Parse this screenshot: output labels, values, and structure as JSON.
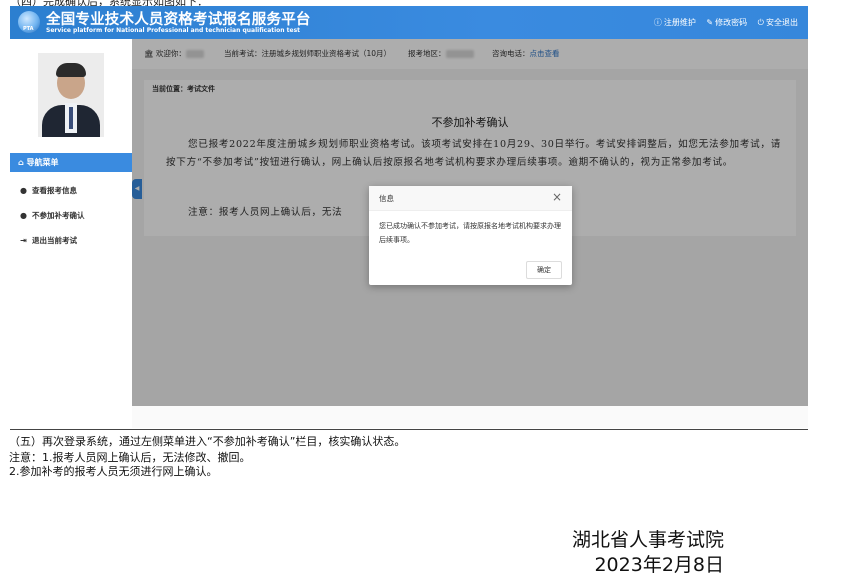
{
  "doc": {
    "top_cut_text": "（四）完成确认后，系统显示如图如下：",
    "step5": "（五）再次登录系统，通过左侧菜单进入“不参加补考确认”栏目，核实确认状态。",
    "note1": "注意：1.报考人员网上确认后，无法修改、撤回。",
    "note2": "2.参加补考的报考人员无须进行网上确认。",
    "signature_org": "湖北省人事考试院",
    "signature_date": "2023年2月8日"
  },
  "app": {
    "logo_text": "PTA",
    "title_cn": "全国专业技术人员资格考试报名服务平台",
    "title_en": "Service platform for National Professional and technician qualification test",
    "header_links": [
      {
        "icon": "info-icon",
        "label": "注册维护"
      },
      {
        "icon": "edit-icon",
        "label": "修改密码"
      },
      {
        "icon": "power-icon",
        "label": "安全退出"
      }
    ],
    "info_bar": {
      "welcome_label": "欢迎你：",
      "exam_label": "当前考试：",
      "exam_value": "注册城乡规划师职业资格考试（10月）",
      "region_label": "报考地区：",
      "phone_label": "咨询电话：",
      "phone_link": "点击查看"
    },
    "nav": {
      "header": "导航菜单",
      "items": [
        {
          "icon": "info-icon",
          "label": "查看报考信息"
        },
        {
          "icon": "info-icon",
          "label": "不参加补考确认"
        },
        {
          "icon": "logout-icon",
          "label": "退出当前考试"
        }
      ]
    },
    "breadcrumb": "当前位置：考试文件",
    "panel": {
      "title": "不参加补考确认",
      "body": "您已报考2022年度注册城乡规划师职业资格考试。该项考试安排在10月29、30日举行。考试安排调整后，如您无法参加考试，请按下方“不参加考试”按钮进行确认，网上确认后按原报名地考试机构要求办理后续事项。逾期不确认的，视为正常参加考试。",
      "note": "注意：报考人员网上确认后，无法"
    },
    "modal": {
      "title": "信息",
      "message": "您已成功确认不参加考试，请按原报名地考试机构要求办理后续事项。",
      "ok_label": "确定"
    }
  }
}
